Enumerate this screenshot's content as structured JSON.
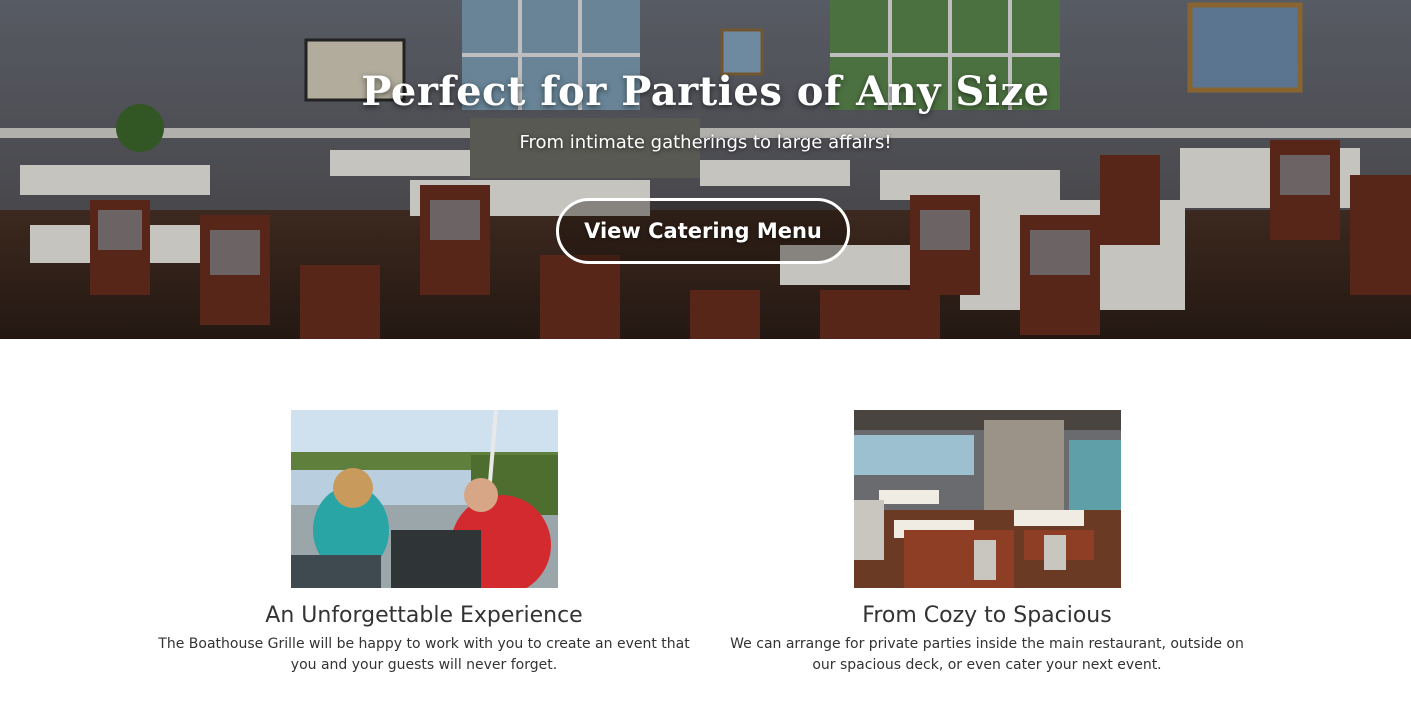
{
  "hero": {
    "title": "Perfect for Parties of Any Size",
    "subtitle": "From intimate gatherings to large affairs!",
    "button_label": "View Catering Menu"
  },
  "cards": [
    {
      "title": "An Unforgettable Experience",
      "text": "The Boathouse Grille will be happy to work with you to create an event that you and your guests will never forget."
    },
    {
      "title": "From Cozy to Spacious",
      "text": "We can arrange for private parties inside the main restaurant, outside on our spacious deck, or even cater your next event."
    }
  ],
  "colors": {
    "text": "#333333",
    "button_border": "#ffffff",
    "background": "#ffffff"
  }
}
